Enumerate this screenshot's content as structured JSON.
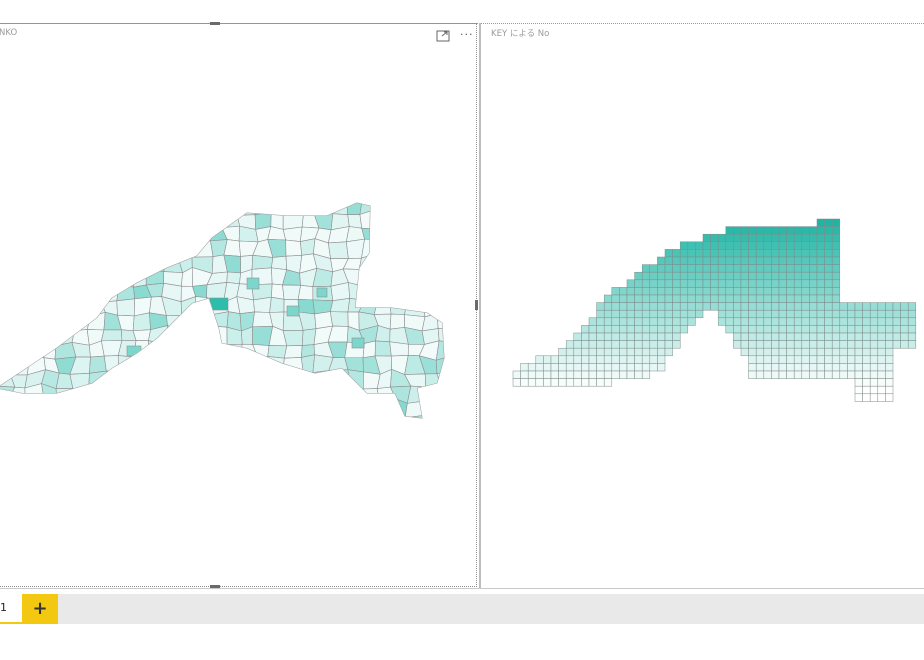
{
  "visuals": [
    {
      "title": "NKO"
    },
    {
      "title": "KEY による No"
    }
  ],
  "tabs": {
    "pages": [
      {
        "label": "1"
      }
    ],
    "add_label": "+"
  },
  "toolbar": {
    "focus_icon": "focus-mode-icon",
    "more_icon": "more-options-icon",
    "more_label": "···"
  },
  "colors": {
    "accent": "#f2c811",
    "map_fill": "#2dbdad",
    "map_low": "#f2fbfa",
    "map_border": "#8a8a8a"
  }
}
